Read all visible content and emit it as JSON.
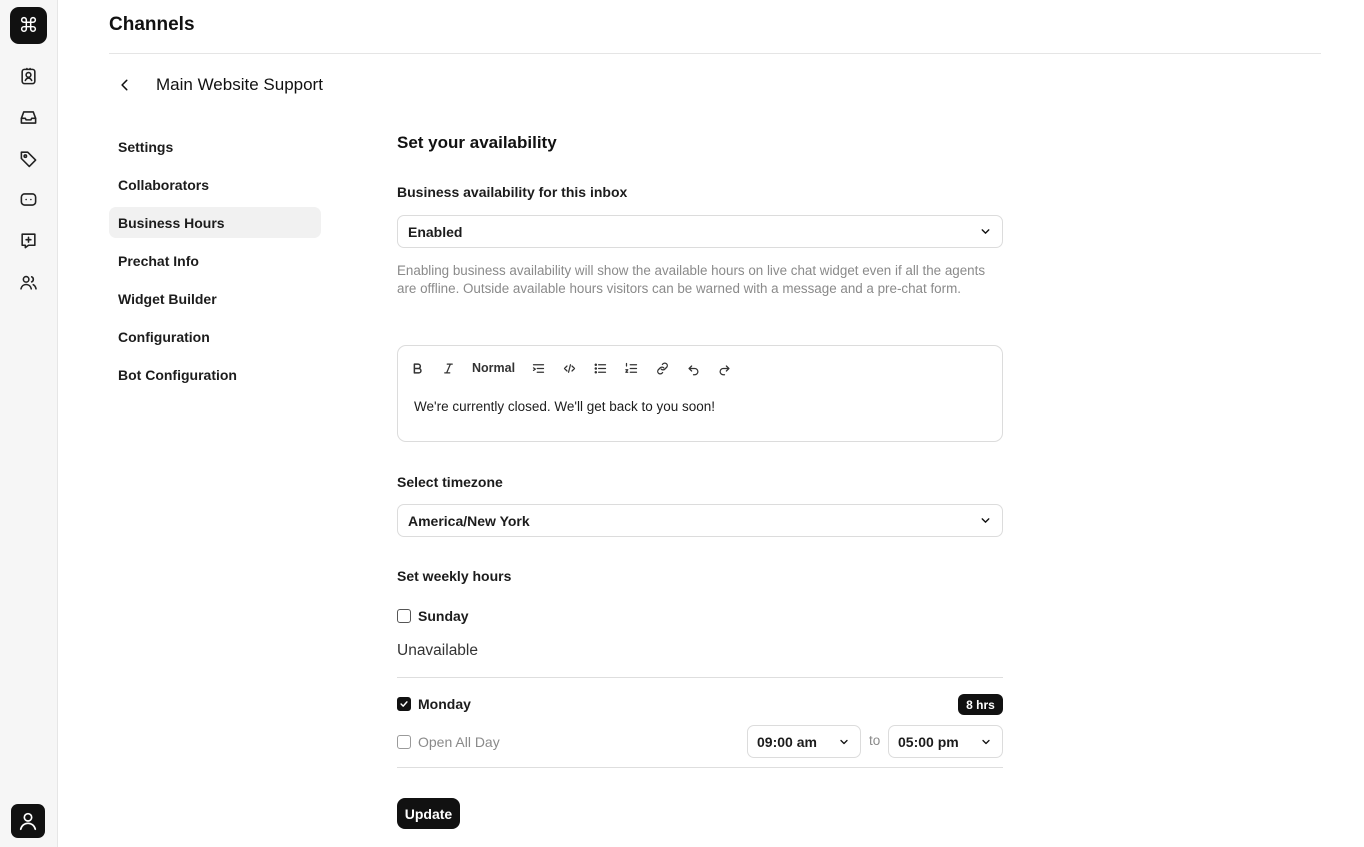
{
  "app": {
    "logo_glyph": "⌘",
    "page_title": "Channels"
  },
  "rail": {
    "items": [
      "contacts-icon",
      "inbox-icon",
      "tag-icon",
      "bot-icon",
      "add-note-icon",
      "team-icon"
    ],
    "profile": "user-avatar-icon"
  },
  "inbox": {
    "title": "Main Website Support"
  },
  "subnav": {
    "items": [
      {
        "label": "Settings",
        "active": false
      },
      {
        "label": "Collaborators",
        "active": false
      },
      {
        "label": "Business Hours",
        "active": true
      },
      {
        "label": "Prechat Info",
        "active": false
      },
      {
        "label": "Widget Builder",
        "active": false
      },
      {
        "label": "Configuration",
        "active": false
      },
      {
        "label": "Bot Configuration",
        "active": false
      }
    ]
  },
  "availability": {
    "section_title": "Set your availability",
    "business_label": "Business availability for this inbox",
    "business_value": "Enabled",
    "help_text": "Enabling business availability will show the available hours on live chat widget even if all the agents are offline. Outside available hours visitors can be warned with a message and a pre-chat form."
  },
  "editor": {
    "toolbar": {
      "bold": "bold-icon",
      "italic": "italic-icon",
      "heading": "Normal",
      "indent": "indent-list-icon",
      "code": "code-icon",
      "bullets": "bullet-list-icon",
      "numbered": "numbered-list-icon",
      "link": "link-icon",
      "undo": "undo-icon",
      "redo": "redo-icon"
    },
    "content": "We're currently closed. We'll get back to you soon!"
  },
  "timezone": {
    "label": "Select timezone",
    "value": "America/New York"
  },
  "weekly": {
    "label": "Set weekly hours",
    "sunday": {
      "name": "Sunday",
      "checked": false,
      "status": "Unavailable"
    },
    "monday": {
      "name": "Monday",
      "checked": true,
      "hours_badge": "8 hrs",
      "open_all_day_label": "Open All Day",
      "open_all_day_checked": false,
      "from": "09:00 am",
      "to_label": "to",
      "to": "05:00 pm"
    }
  },
  "actions": {
    "update_label": "Update"
  },
  "colors": {
    "accent": "#111111",
    "muted_text": "#8a8a8a",
    "border": "#dcdcdc",
    "active_nav_bg": "#f1f1f1"
  }
}
